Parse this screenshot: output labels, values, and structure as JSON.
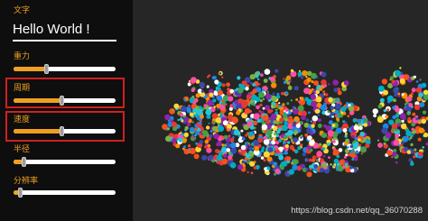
{
  "panel": {
    "text_label": "文字",
    "text_value": "Hello World !",
    "sliders": [
      {
        "id": "gravity",
        "label": "重力",
        "value": 0.32
      },
      {
        "id": "period",
        "label": "周期",
        "value": 0.47
      },
      {
        "id": "speed",
        "label": "速度",
        "value": 0.47
      },
      {
        "id": "radius",
        "label": "半径",
        "value": 0.1
      },
      {
        "id": "resolution",
        "label": "分辨率",
        "value": 0.06
      }
    ],
    "highlight_color": "#d21f1f",
    "accent_color": "#f0a020"
  },
  "watermark": "https://blog.csdn.net/qq_36070288"
}
